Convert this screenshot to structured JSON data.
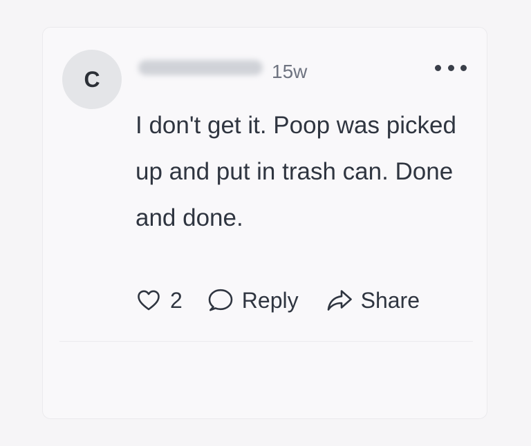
{
  "comment": {
    "author_initial": "C",
    "timestamp": "15w",
    "text": "I don't get it. Poop was picked up and put in trash can. Done and done.",
    "like_count": "2",
    "reply_label": "Reply",
    "share_label": "Share"
  },
  "icons": {
    "like": "heart-icon",
    "reply": "speech-bubble-icon",
    "share": "share-arrow-icon",
    "more": "more-horizontal-icon"
  },
  "colors": {
    "text": "#2f3540",
    "meta": "#6e7380",
    "avatar_bg": "#e4e5e8"
  }
}
